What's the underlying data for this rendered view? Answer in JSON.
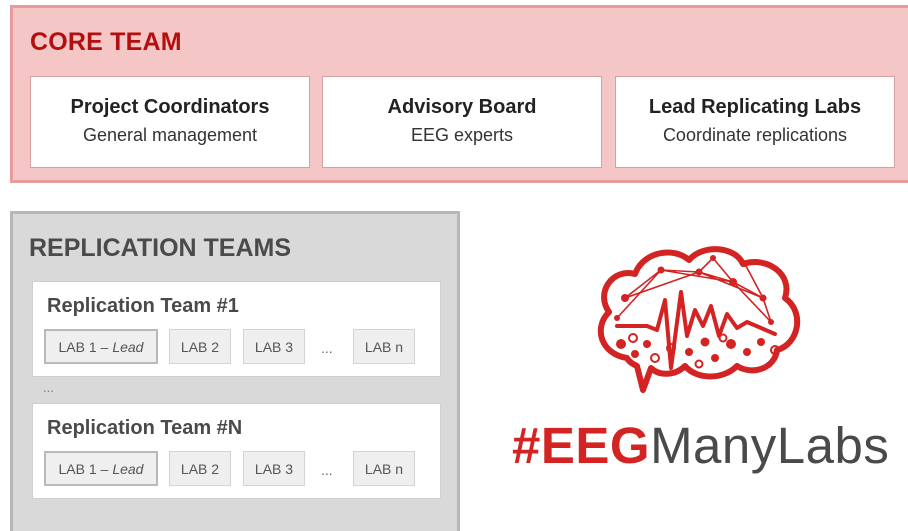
{
  "core": {
    "title": "CORE TEAM",
    "cards": [
      {
        "title": "Project Coordinators",
        "subtitle": "General management"
      },
      {
        "title": "Advisory Board",
        "subtitle": "EEG experts"
      },
      {
        "title": "Lead Replicating Labs",
        "subtitle": "Coordinate replications"
      }
    ]
  },
  "replication": {
    "title": "REPLICATION TEAMS",
    "gap_ellipsis": "...",
    "teams": [
      {
        "title": "Replication Team #1",
        "lead_label": "LAB 1 –",
        "lead_tag": "Lead",
        "labs": [
          "LAB 2",
          "LAB 3"
        ],
        "ellipsis": "...",
        "last": "LAB n"
      },
      {
        "title": "Replication Team #N",
        "lead_label": "LAB 1 –",
        "lead_tag": "Lead",
        "labs": [
          "LAB 2",
          "LAB 3"
        ],
        "ellipsis": "...",
        "last": "LAB n"
      }
    ]
  },
  "brand": {
    "hash": "#",
    "bold": "EEG",
    "rest": "ManyLabs",
    "logo_icon": "brain-eeg-icon",
    "accent": "#d32323",
    "text_color": "#4a4a4a"
  }
}
